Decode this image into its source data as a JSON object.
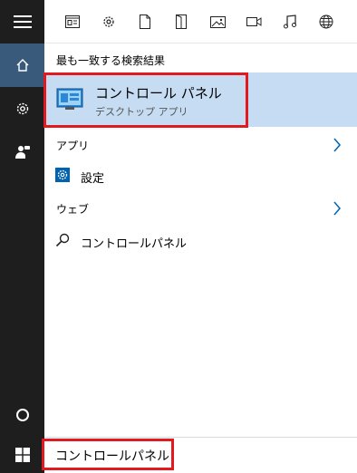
{
  "filter_bar": {
    "icons": [
      "apps-icon",
      "settings-icon",
      "document-icon",
      "folders-icon",
      "photos-icon",
      "video-icon",
      "music-icon",
      "web-icon"
    ]
  },
  "results": {
    "best_match_header": "最も一致する検索結果",
    "best_match": {
      "title": "コントロール パネル",
      "subtitle": "デスクトップ アプリ"
    },
    "apps_header": "アプリ",
    "apps_item": "設定",
    "web_header": "ウェブ",
    "web_item": "コントロールパネル"
  },
  "search": {
    "value": "コントロールパネル"
  },
  "colors": {
    "rail": "#1e1e1e",
    "rail_active": "#3a5a7c",
    "selected": "#c6dcf2",
    "highlight": "#e2191f",
    "accent": "#0063b1"
  }
}
